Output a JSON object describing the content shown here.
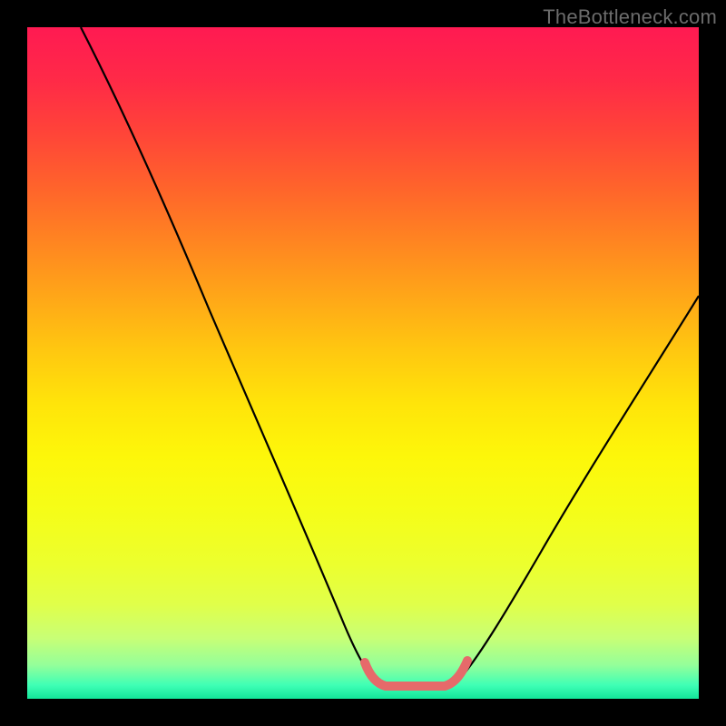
{
  "watermark": "TheBottleneck.com",
  "chart_data": {
    "type": "line",
    "title": "",
    "xlabel": "",
    "ylabel": "",
    "xlim": [
      0,
      100
    ],
    "ylim": [
      0,
      100
    ],
    "series": [
      {
        "name": "bottleneck-curve",
        "x": [
          8,
          12,
          18,
          24,
          30,
          36,
          42,
          48,
          51,
          53,
          55,
          57,
          59,
          61,
          63,
          66,
          72,
          78,
          84,
          90,
          96,
          100
        ],
        "y": [
          100,
          92,
          80,
          68,
          56,
          44,
          32,
          16,
          6,
          2,
          1,
          1,
          1,
          1,
          2,
          6,
          16,
          26,
          36,
          46,
          55,
          61
        ]
      },
      {
        "name": "optimal-zone-marker",
        "x": [
          51,
          53,
          55,
          57,
          59,
          61,
          63
        ],
        "y": [
          5,
          2,
          1,
          1,
          1,
          2,
          5
        ]
      }
    ],
    "gradient_colors": {
      "top": "#ff1a52",
      "mid": "#ffe40a",
      "bottom": "#13e59a"
    },
    "curve_color": "#000000",
    "marker_color": "#e66a6a"
  }
}
